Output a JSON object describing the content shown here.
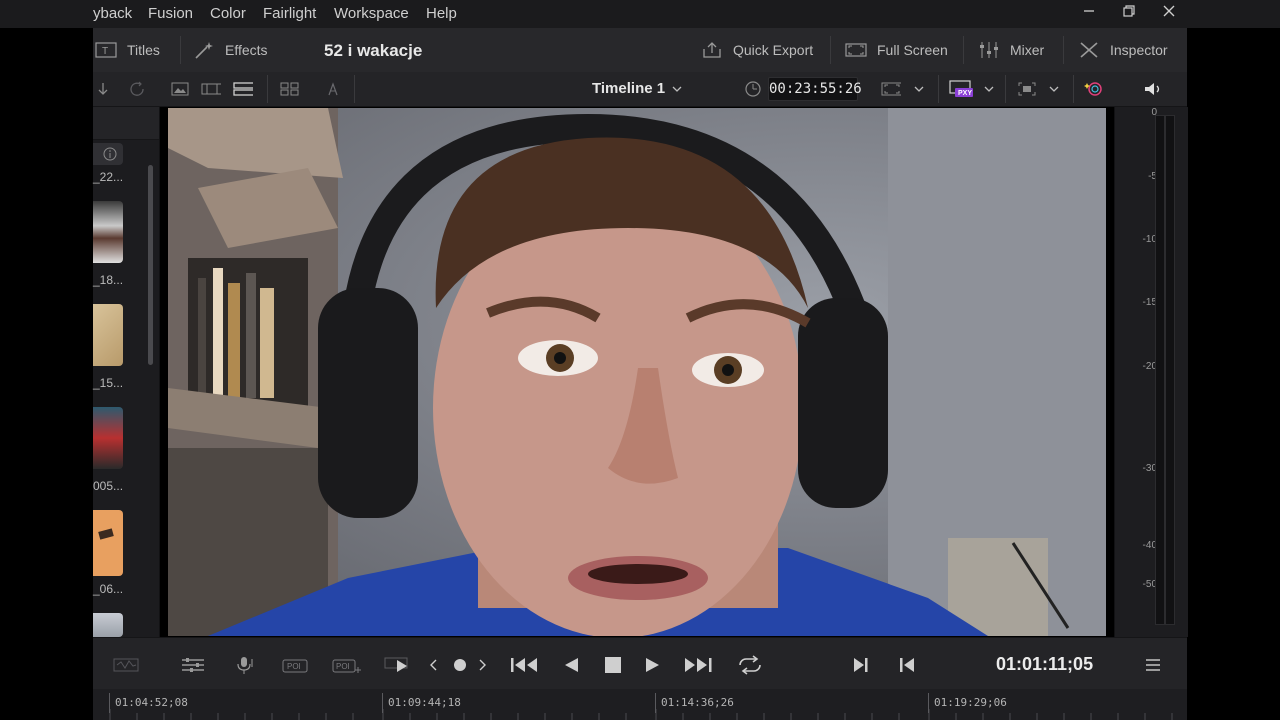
{
  "menu": [
    "yback",
    "Fusion",
    "Color",
    "Fairlight",
    "Workspace",
    "Help"
  ],
  "window_controls": [
    "minimize-icon",
    "restore-icon",
    "close-icon"
  ],
  "toolbar": {
    "titles_label": "Titles",
    "effects_label": "Effects",
    "project_title": "52 i wakacje",
    "quick_export_label": "Quick Export",
    "full_screen_label": "Full Screen",
    "mixer_label": "Mixer",
    "inspector_label": "Inspector"
  },
  "viewer_bar": {
    "timeline_name": "Timeline 1",
    "timecode": "00:23:55:26",
    "proxy_badge": "PXY"
  },
  "media_pool": {
    "clips": [
      {
        "label": "_22..."
      },
      {
        "label": "_18..."
      },
      {
        "label": "_15..."
      },
      {
        "label": "005..."
      },
      {
        "label": "_06..."
      }
    ]
  },
  "audio_meter": {
    "scale": [
      "0",
      "-5",
      "-10",
      "-15",
      "-20",
      "-30",
      "-40",
      "-50"
    ]
  },
  "transport": {
    "timecode": "01:01:11;05"
  },
  "ruler": {
    "labels": [
      "01:04:52;08",
      "01:09:44;18",
      "01:14:36;26",
      "01:19:29;06"
    ]
  },
  "colors": {
    "accent_purple": "#8b3fd6",
    "background": "#1f1f22"
  }
}
